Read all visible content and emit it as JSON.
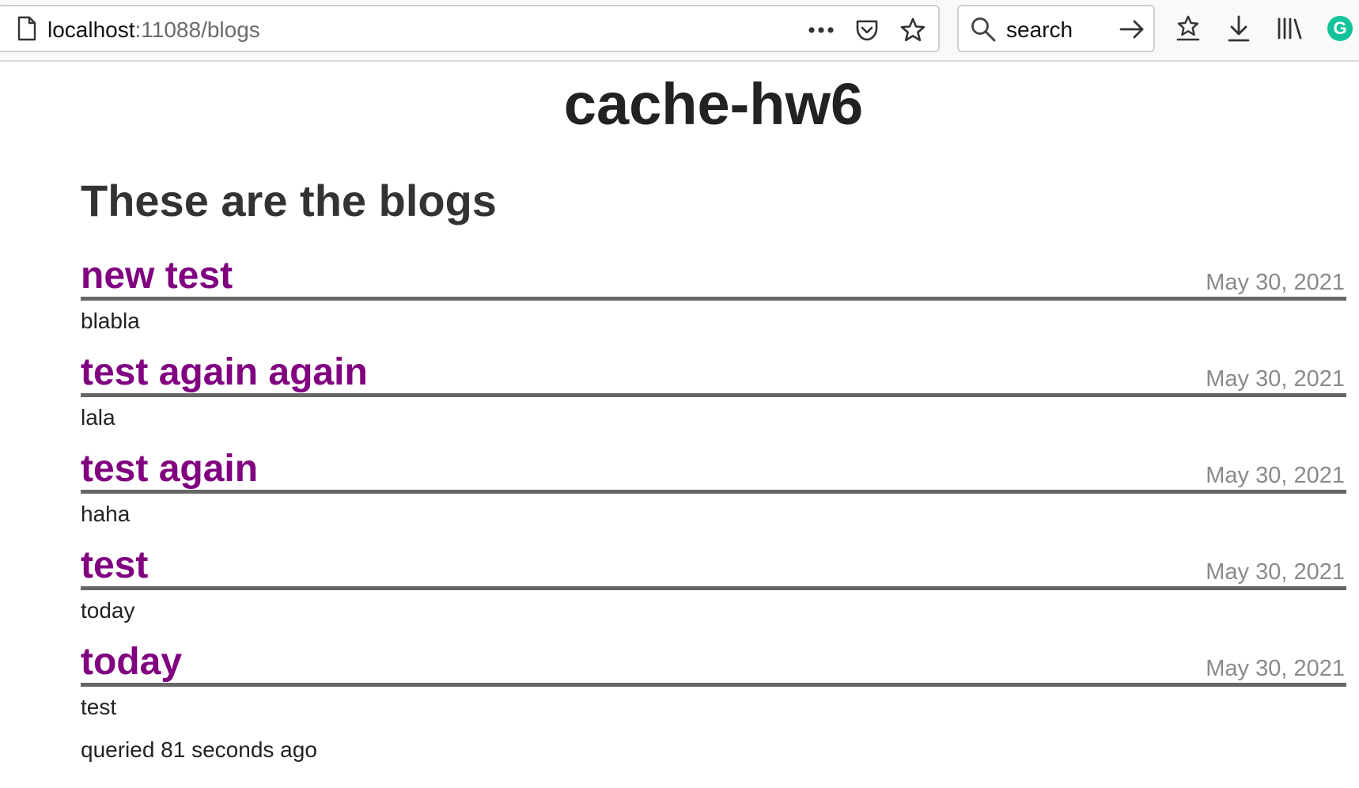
{
  "browser": {
    "url_host": "localhost",
    "url_rest": ":11088/blogs",
    "search_placeholder": "search"
  },
  "page": {
    "site_title": "cache-hw6",
    "section_heading": "These are the blogs",
    "queried_text": "queried 81 seconds ago"
  },
  "blogs": [
    {
      "title": "new test",
      "date": "May 30, 2021",
      "body": "blabla"
    },
    {
      "title": "test again again",
      "date": "May 30, 2021",
      "body": "lala"
    },
    {
      "title": "test again",
      "date": "May 30, 2021",
      "body": "haha"
    },
    {
      "title": "test",
      "date": "May 30, 2021",
      "body": "today"
    },
    {
      "title": "today",
      "date": "May 30, 2021",
      "body": "test"
    }
  ],
  "colors": {
    "link": "#800080",
    "date": "#8a8a8a",
    "divider": "#666666",
    "grammarly": "#15c39a"
  },
  "icons": {
    "grammarly_letter": "G"
  }
}
